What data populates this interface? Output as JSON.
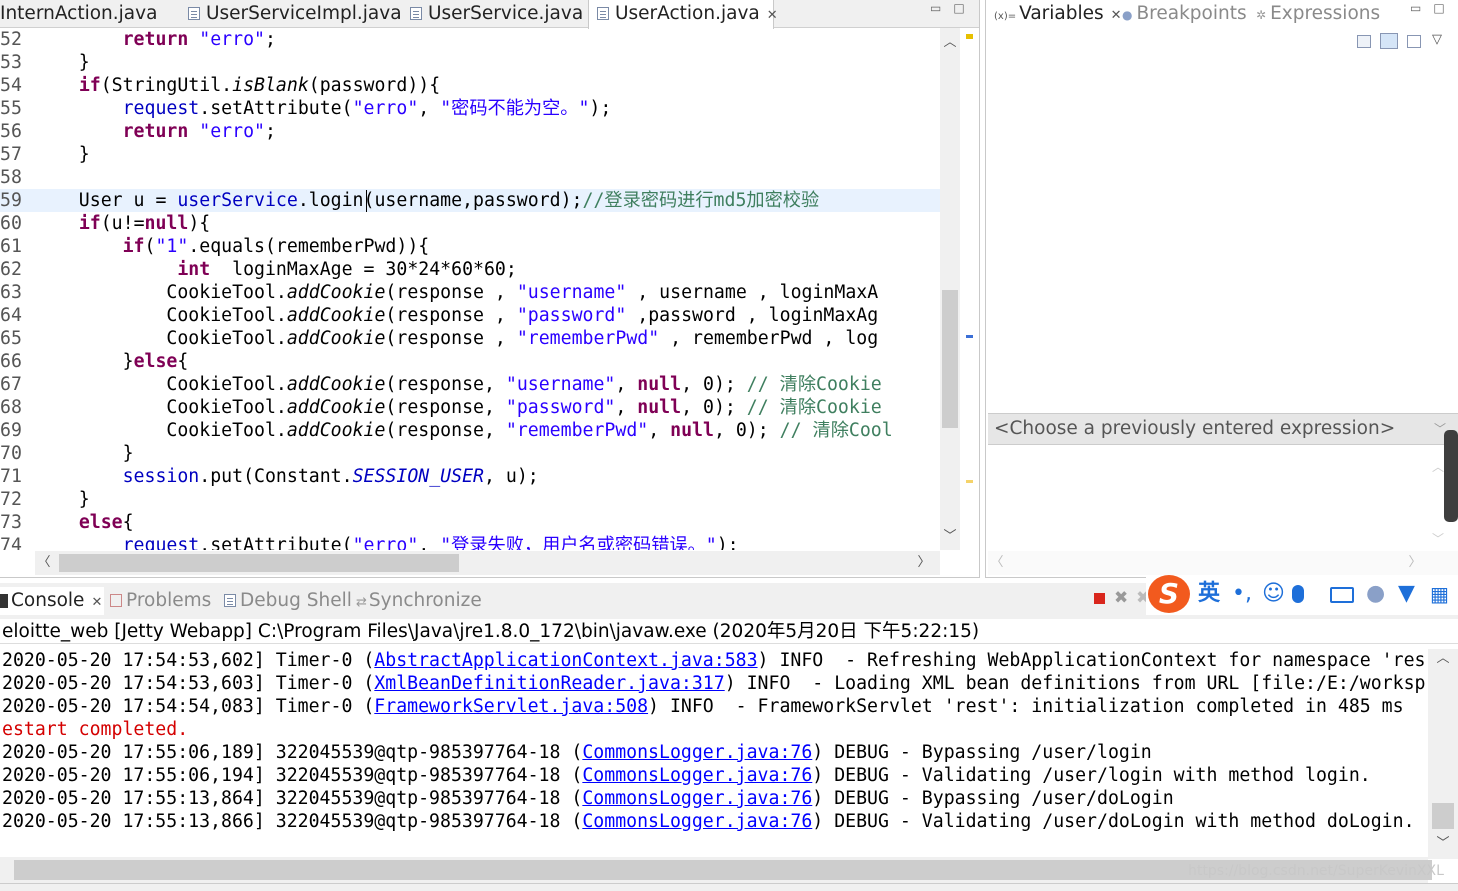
{
  "editor": {
    "tabs": [
      {
        "label": "InternAction.java"
      },
      {
        "label": "UserServiceImpl.java"
      },
      {
        "label": "UserService.java"
      },
      {
        "label": "UserAction.java",
        "close": "✕"
      }
    ]
  },
  "code_lines": [
    {
      "num": "52",
      "segs": [
        [
          "p",
          "        "
        ],
        [
          "kw",
          "return"
        ],
        [
          "p",
          " "
        ],
        [
          "str",
          "\"erro\""
        ],
        [
          "p",
          ";"
        ]
      ]
    },
    {
      "num": "53",
      "segs": [
        [
          "p",
          "    }"
        ]
      ]
    },
    {
      "num": "54",
      "segs": [
        [
          "p",
          "    "
        ],
        [
          "kw",
          "if"
        ],
        [
          "p",
          "(StringUtil."
        ],
        [
          "it",
          "isBlank"
        ],
        [
          "p",
          "(password)){"
        ]
      ]
    },
    {
      "num": "55",
      "segs": [
        [
          "p",
          "        "
        ],
        [
          "fld",
          "request"
        ],
        [
          "p",
          ".setAttribute("
        ],
        [
          "str",
          "\"erro\""
        ],
        [
          "p",
          ", "
        ],
        [
          "str",
          "\"密码不能为空。\""
        ],
        [
          "p",
          ");"
        ]
      ]
    },
    {
      "num": "56",
      "segs": [
        [
          "p",
          "        "
        ],
        [
          "kw",
          "return"
        ],
        [
          "p",
          " "
        ],
        [
          "str",
          "\"erro\""
        ],
        [
          "p",
          ";"
        ]
      ]
    },
    {
      "num": "57",
      "segs": [
        [
          "p",
          "    }"
        ]
      ]
    },
    {
      "num": "58",
      "segs": [
        [
          "p",
          ""
        ]
      ]
    },
    {
      "num": "59",
      "current": true,
      "segs": [
        [
          "p",
          "    User u = "
        ],
        [
          "fld",
          "userService"
        ],
        [
          "p",
          ".login(username,password);"
        ],
        [
          "cmt",
          "//登录密码进行md5加密校验"
        ]
      ]
    },
    {
      "num": "60",
      "segs": [
        [
          "p",
          "    "
        ],
        [
          "kw",
          "if"
        ],
        [
          "p",
          "(u!="
        ],
        [
          "kw",
          "null"
        ],
        [
          "p",
          "){"
        ]
      ]
    },
    {
      "num": "61",
      "segs": [
        [
          "p",
          "        "
        ],
        [
          "kw",
          "if"
        ],
        [
          "p",
          "("
        ],
        [
          "str",
          "\"1\""
        ],
        [
          "p",
          ".equals(rememberPwd)){"
        ]
      ]
    },
    {
      "num": "62",
      "segs": [
        [
          "p",
          "             "
        ],
        [
          "kw",
          "int"
        ],
        [
          "p",
          "  loginMaxAge = 30*24*60*60;"
        ]
      ]
    },
    {
      "num": "63",
      "segs": [
        [
          "p",
          "            CookieTool."
        ],
        [
          "it",
          "addCookie"
        ],
        [
          "p",
          "(response , "
        ],
        [
          "str",
          "\"username\""
        ],
        [
          "p",
          " , username , loginMaxA"
        ]
      ]
    },
    {
      "num": "64",
      "segs": [
        [
          "p",
          "            CookieTool."
        ],
        [
          "it",
          "addCookie"
        ],
        [
          "p",
          "(response , "
        ],
        [
          "str",
          "\"password\""
        ],
        [
          "p",
          " ,password , loginMaxAg"
        ]
      ]
    },
    {
      "num": "65",
      "segs": [
        [
          "p",
          "            CookieTool."
        ],
        [
          "it",
          "addCookie"
        ],
        [
          "p",
          "(response , "
        ],
        [
          "str",
          "\"rememberPwd\""
        ],
        [
          "p",
          " , rememberPwd , log"
        ]
      ]
    },
    {
      "num": "66",
      "segs": [
        [
          "p",
          "        }"
        ],
        [
          "kw",
          "else"
        ],
        [
          "p",
          "{"
        ]
      ]
    },
    {
      "num": "67",
      "segs": [
        [
          "p",
          "            CookieTool."
        ],
        [
          "it",
          "addCookie"
        ],
        [
          "p",
          "(response, "
        ],
        [
          "str",
          "\"username\""
        ],
        [
          "p",
          ", "
        ],
        [
          "kw",
          "null"
        ],
        [
          "p",
          ", 0); "
        ],
        [
          "cmt",
          "// 清除Cookie"
        ]
      ]
    },
    {
      "num": "68",
      "segs": [
        [
          "p",
          "            CookieTool."
        ],
        [
          "it",
          "addCookie"
        ],
        [
          "p",
          "(response, "
        ],
        [
          "str",
          "\"password\""
        ],
        [
          "p",
          ", "
        ],
        [
          "kw",
          "null"
        ],
        [
          "p",
          ", 0); "
        ],
        [
          "cmt",
          "// 清除Cookie"
        ]
      ]
    },
    {
      "num": "69",
      "segs": [
        [
          "p",
          "            CookieTool."
        ],
        [
          "it",
          "addCookie"
        ],
        [
          "p",
          "(response, "
        ],
        [
          "str",
          "\"rememberPwd\""
        ],
        [
          "p",
          ", "
        ],
        [
          "kw",
          "null"
        ],
        [
          "p",
          ", 0); "
        ],
        [
          "cmt",
          "// 清除Cool"
        ]
      ]
    },
    {
      "num": "70",
      "segs": [
        [
          "p",
          "        }"
        ]
      ]
    },
    {
      "num": "71",
      "segs": [
        [
          "p",
          "        "
        ],
        [
          "fld",
          "session"
        ],
        [
          "p",
          ".put(Constant."
        ],
        [
          "sf",
          "SESSION_USER"
        ],
        [
          "p",
          ", u);"
        ]
      ]
    },
    {
      "num": "72",
      "segs": [
        [
          "p",
          "    }"
        ]
      ]
    },
    {
      "num": "73",
      "segs": [
        [
          "p",
          "    "
        ],
        [
          "kw",
          "else"
        ],
        [
          "p",
          "{"
        ]
      ]
    },
    {
      "num": "74",
      "segs": [
        [
          "p",
          "        "
        ],
        [
          "fld",
          "request"
        ],
        [
          "p",
          ".setAttribute("
        ],
        [
          "str",
          "\"erro\""
        ],
        [
          "p",
          ", "
        ],
        [
          "str",
          "\"登录失败，用户名或密码错误。\""
        ],
        [
          "p",
          ");"
        ]
      ]
    }
  ],
  "variables": {
    "tabs": [
      {
        "label": "Variables",
        "close": "✕"
      },
      {
        "label": "Breakpoints"
      },
      {
        "label": "Expressions"
      }
    ],
    "expression_placeholder": "<Choose a previously entered expression>"
  },
  "console": {
    "tabs": [
      {
        "label": "Console",
        "close": "✕"
      },
      {
        "label": "Problems"
      },
      {
        "label": "Debug Shell"
      },
      {
        "label": "Synchronize"
      }
    ],
    "launch": "eloitte_web [Jetty Webapp] C:\\Program Files\\Java\\jre1.8.0_172\\bin\\javaw.exe (2020年5月20日 下午5:22:15)",
    "lines": [
      {
        "segs": [
          [
            "p",
            "2020-05-20 17:54:53,602] Timer-0 ("
          ],
          [
            "link",
            "AbstractApplicationContext.java:583"
          ],
          [
            "p",
            ") INFO  - Refreshing WebApplicationContext for namespace 'res"
          ]
        ]
      },
      {
        "segs": [
          [
            "p",
            "2020-05-20 17:54:53,603] Timer-0 ("
          ],
          [
            "link",
            "XmlBeanDefinitionReader.java:317"
          ],
          [
            "p",
            ") INFO  - Loading XML bean definitions from URL [file:/E:/worksp"
          ]
        ]
      },
      {
        "segs": [
          [
            "p",
            "2020-05-20 17:54:54,083] Timer-0 ("
          ],
          [
            "link",
            "FrameworkServlet.java:508"
          ],
          [
            "p",
            ") INFO  - FrameworkServlet 'rest': initialization completed in 485 ms"
          ]
        ]
      },
      {
        "segs": [
          [
            "red",
            "estart completed."
          ]
        ]
      },
      {
        "segs": [
          [
            "p",
            "2020-05-20 17:55:06,189] 322045539@qtp-985397764-18 ("
          ],
          [
            "link",
            "CommonsLogger.java:76"
          ],
          [
            "p",
            ") DEBUG - Bypassing /user/login"
          ]
        ]
      },
      {
        "segs": [
          [
            "p",
            "2020-05-20 17:55:06,194] 322045539@qtp-985397764-18 ("
          ],
          [
            "link",
            "CommonsLogger.java:76"
          ],
          [
            "p",
            ") DEBUG - Validating /user/login with method login."
          ]
        ]
      },
      {
        "segs": [
          [
            "p",
            "2020-05-20 17:55:13,864] 322045539@qtp-985397764-18 ("
          ],
          [
            "link",
            "CommonsLogger.java:76"
          ],
          [
            "p",
            ") DEBUG - Bypassing /user/doLogin"
          ]
        ]
      },
      {
        "segs": [
          [
            "p",
            "2020-05-20 17:55:13,866] 322045539@qtp-985397764-18 ("
          ],
          [
            "link",
            "CommonsLogger.java:76"
          ],
          [
            "p",
            ") DEBUG - Validating /user/doLogin with method doLogin."
          ]
        ]
      }
    ]
  },
  "ime": {
    "logo": "S",
    "lang": "英",
    "punct": "•,",
    "emoji": "☺"
  },
  "watermark": "https://blog.csdn.net/SuperKevinXXL",
  "colors": {
    "keyword": "#7f0055",
    "string": "#2a00ff",
    "comment": "#3f7f5f",
    "field": "#0000c0",
    "link": "#0000ff",
    "error": "#d40000",
    "current_line": "#e8f2fe"
  }
}
